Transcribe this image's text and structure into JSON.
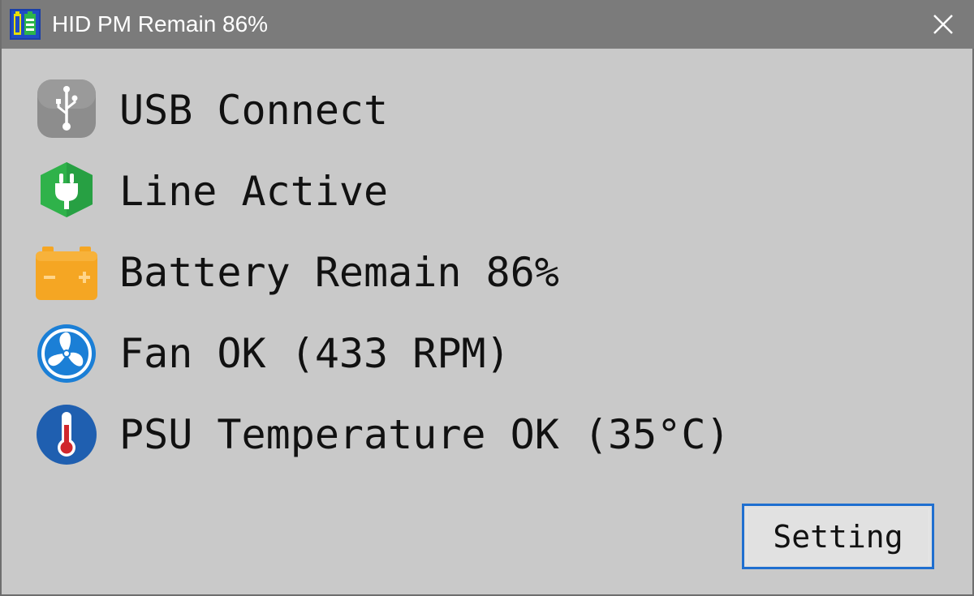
{
  "window": {
    "title": "HID PM Remain 86%",
    "app_icon": "battery-app-icon",
    "close_icon": "close-icon"
  },
  "status": {
    "items": [
      {
        "icon": "usb-icon",
        "label": "USB Connect",
        "color": "#8f8f8f"
      },
      {
        "icon": "power-plug-icon",
        "label": "Line Active",
        "color": "#2fb24a"
      },
      {
        "icon": "battery-icon",
        "label": "Battery Remain 86%",
        "color": "#f5a623"
      },
      {
        "icon": "fan-icon",
        "label": "Fan OK (433 RPM)",
        "color": "#1b7fd6"
      },
      {
        "icon": "thermometer-icon",
        "label": "PSU Temperature OK (35°C)",
        "color": "#1f5fb0"
      }
    ]
  },
  "actions": {
    "setting_label": "Setting"
  },
  "colors": {
    "titlebar_bg": "#7b7b7b",
    "window_bg": "#c9c9c9",
    "button_border": "#1f6fd0"
  }
}
